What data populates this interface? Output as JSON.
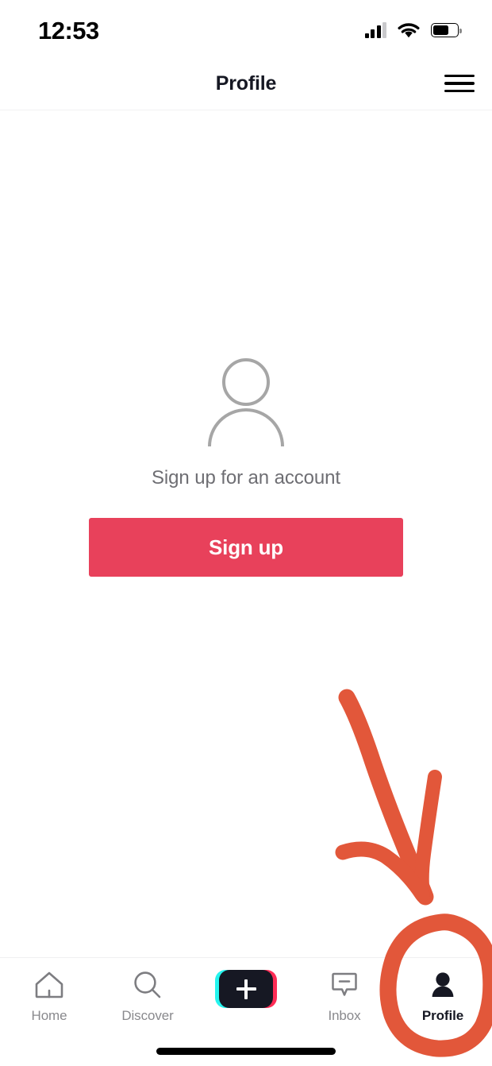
{
  "status_bar": {
    "time": "12:53",
    "signal_icon": "cellular-signal-icon",
    "wifi_icon": "wifi-icon",
    "battery_icon": "battery-icon",
    "battery_level_percent": 65
  },
  "header": {
    "title": "Profile",
    "menu_icon": "hamburger-menu-icon"
  },
  "main": {
    "avatar_icon": "person-outline-avatar-icon",
    "caption": "Sign up for an account",
    "signup_button_label": "Sign up",
    "signup_button_color": "#e8415b"
  },
  "tab_bar": {
    "tabs": [
      {
        "label": "Home",
        "icon": "home-icon",
        "active": false
      },
      {
        "label": "Discover",
        "icon": "search-icon",
        "active": false
      },
      {
        "label": "",
        "icon": "create-plus-icon",
        "active": false
      },
      {
        "label": "Inbox",
        "icon": "inbox-message-icon",
        "active": false
      },
      {
        "label": "Profile",
        "icon": "person-filled-icon",
        "active": true
      }
    ],
    "active_color": "#161823",
    "inactive_color": "#89898d",
    "create_accent_cyan": "#25f4ee",
    "create_accent_pink": "#fe2c55"
  },
  "annotations": {
    "color": "#e2573a",
    "arrow": "down-right-arrow-annotation",
    "circle": "circle-highlight-annotation-on-profile-tab"
  }
}
